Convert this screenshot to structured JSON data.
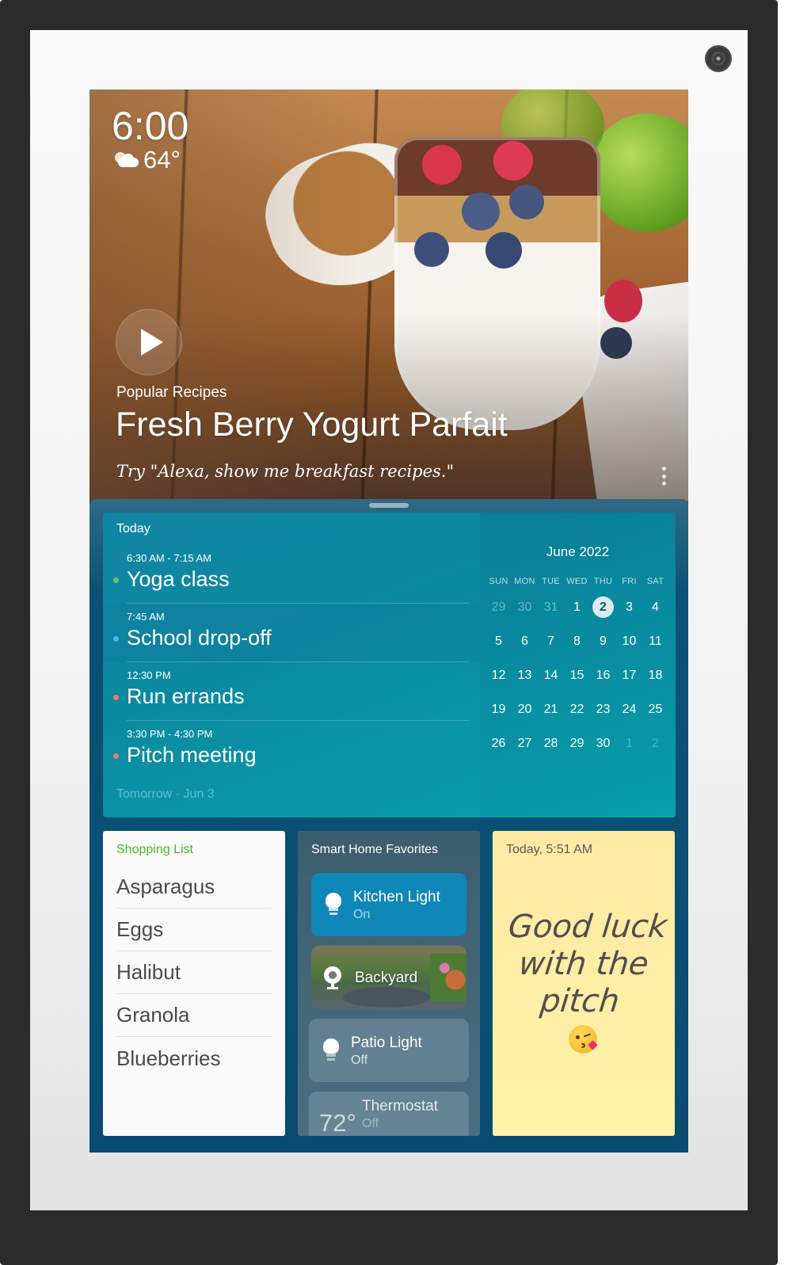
{
  "status": {
    "time": "6:00",
    "temperature": "64°",
    "weather_icon": "partly-sunny-icon"
  },
  "hero": {
    "category": "Popular Recipes",
    "title": "Fresh Berry Yogurt Parfait",
    "hint": "Try \"Alexa, show me breakfast recipes.\"",
    "play_icon": "play-icon",
    "more_icon": "more-vertical-icon"
  },
  "agenda": {
    "heading": "Today",
    "events": [
      {
        "time": "6:30 AM - 7:15 AM",
        "title": "Yoga class",
        "dot_color": "#5fcf5a"
      },
      {
        "time": "7:45 AM",
        "title": "School drop-off",
        "dot_color": "#31c4ef"
      },
      {
        "time": "12:30 PM",
        "title": "Run errands",
        "dot_color": "#f07a6a"
      },
      {
        "time": "3:30 PM - 4:30 PM",
        "title": "Pitch meeting",
        "dot_color": "#f07a6a"
      }
    ],
    "next_day": "Tomorrow · Jun 3"
  },
  "calendar": {
    "month": "June 2022",
    "weekdays": [
      "SUN",
      "MON",
      "TUE",
      "WED",
      "THU",
      "FRI",
      "SAT"
    ],
    "weeks": [
      [
        "29",
        "30",
        "31",
        "1",
        "2",
        "3",
        "4"
      ],
      [
        "5",
        "6",
        "7",
        "8",
        "9",
        "10",
        "11"
      ],
      [
        "12",
        "13",
        "14",
        "15",
        "16",
        "17",
        "18"
      ],
      [
        "19",
        "20",
        "21",
        "22",
        "23",
        "24",
        "25"
      ],
      [
        "26",
        "27",
        "28",
        "29",
        "30",
        "1",
        "2"
      ]
    ],
    "today": "2"
  },
  "shopping": {
    "title": "Shopping List",
    "items": [
      "Asparagus",
      "Eggs",
      "Halibut",
      "Granola",
      "Blueberries"
    ],
    "accent": "#4cb820"
  },
  "smart_home": {
    "title": "Smart Home Favorites",
    "devices": [
      {
        "name": "Kitchen Light",
        "state": "On",
        "icon": "light-bulb-icon"
      },
      {
        "name": "Backyard",
        "state": "",
        "icon": "camera-icon"
      },
      {
        "name": "Patio Light",
        "state": "Off",
        "icon": "light-bulb-icon"
      },
      {
        "name": "Thermostat",
        "state": "Off",
        "temperature": "72°",
        "icon": "thermostat-icon"
      }
    ]
  },
  "note": {
    "timestamp": "Today, 5:51 AM",
    "text": "Good luck with the pitch",
    "emoji": "face-blowing-kiss-icon"
  }
}
